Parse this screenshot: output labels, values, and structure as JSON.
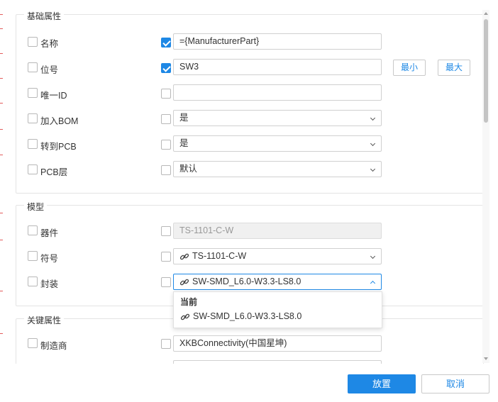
{
  "sections": {
    "basic": {
      "title": "基础属性"
    },
    "model": {
      "title": "模型"
    },
    "key": {
      "title": "关键属性"
    }
  },
  "basic_rows": {
    "name": {
      "label": "名称",
      "value": "={ManufacturerPart}",
      "checked": true
    },
    "designator": {
      "label": "位号",
      "value": "SW3",
      "checked": true,
      "btn_min": "最小",
      "btn_max": "最大"
    },
    "unique_id": {
      "label": "唯一ID",
      "value": ""
    },
    "add_bom": {
      "label": "加入BOM",
      "value": "是"
    },
    "to_pcb": {
      "label": "转到PCB",
      "value": "是"
    },
    "pcb_layer": {
      "label": "PCB层",
      "value": "默认"
    }
  },
  "model_rows": {
    "device": {
      "label": "器件",
      "value": "TS-1101-C-W"
    },
    "symbol": {
      "label": "符号",
      "value": "TS-1101-C-W"
    },
    "footprint": {
      "label": "封装",
      "value": "SW-SMD_L6.0-W3.3-LS8.0"
    }
  },
  "footprint_dropdown": {
    "group_label": "当前",
    "option": "SW-SMD_L6.0-W3.3-LS8.0"
  },
  "key_rows": {
    "manufacturer": {
      "label": "制造商",
      "value": "XKBConnectivity(中国星坤)"
    }
  },
  "footer": {
    "place": "放置",
    "cancel": "取消"
  },
  "colors": {
    "accent": "#1e88e5"
  }
}
